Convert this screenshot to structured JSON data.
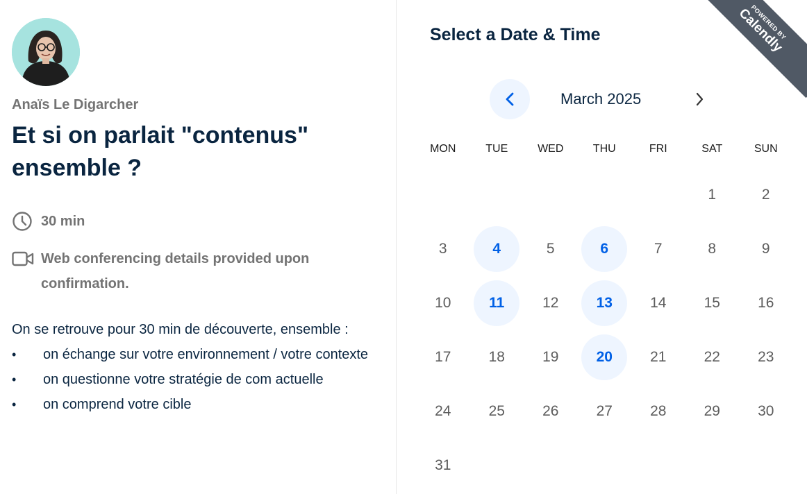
{
  "organizer": {
    "name": "Anaïs Le Digarcher"
  },
  "event": {
    "title": "Et si on parlait \"contenus\" ensemble ?",
    "duration": "30 min",
    "location": "Web conferencing details provided upon confirmation.",
    "description_intro": "On se retrouve pour 30 min de découverte, ensemble :",
    "description_items": [
      "on échange sur votre environnement / votre contexte",
      "on questionne votre stratégie de com actuelle",
      "on comprend votre cible"
    ]
  },
  "calendar": {
    "heading": "Select a Date & Time",
    "month": "March 2025",
    "weekdays": [
      "MON",
      "TUE",
      "WED",
      "THU",
      "FRI",
      "SAT",
      "SUN"
    ],
    "days": [
      "",
      "",
      "",
      "",
      "",
      "1",
      "2",
      "3",
      "4",
      "5",
      "6",
      "7",
      "8",
      "9",
      "10",
      "11",
      "12",
      "13",
      "14",
      "15",
      "16",
      "17",
      "18",
      "19",
      "20",
      "21",
      "22",
      "23",
      "24",
      "25",
      "26",
      "27",
      "28",
      "29",
      "30",
      "31"
    ],
    "available_days": [
      "4",
      "6",
      "11",
      "13",
      "20"
    ]
  },
  "branding": {
    "powered_by": "POWERED BY",
    "brand": "Calendly"
  },
  "colors": {
    "accent": "#0060e6",
    "available_bg": "#eef5ff",
    "title": "#0a2540",
    "ribbon": "#505965"
  },
  "icons": {
    "clock": "clock-icon",
    "video": "video-camera-icon",
    "prev": "chevron-left-icon",
    "next": "chevron-right-icon"
  }
}
